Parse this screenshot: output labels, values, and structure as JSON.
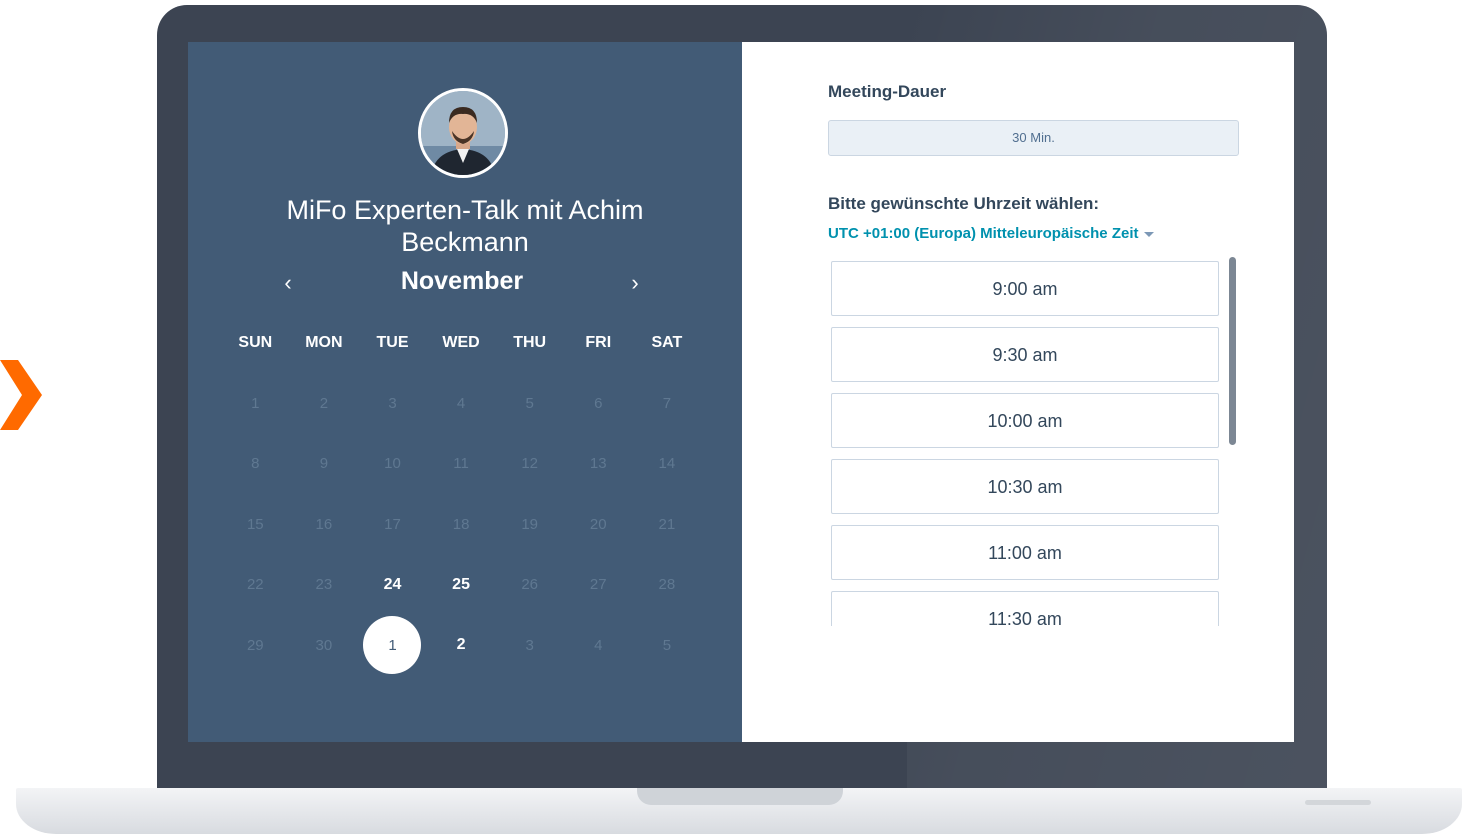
{
  "colors": {
    "left_panel_bg": "#425b76",
    "accent_link": "#0091ae",
    "brand_orange": "#ff6a00",
    "laptop_frame": "#3c4452"
  },
  "calendar": {
    "meeting_title": "MiFo Experten-Talk mit Achim Beckmann",
    "month": "November",
    "prev_icon": "chevron-left-icon",
    "next_icon": "chevron-right-icon",
    "weekdays": [
      "SUN",
      "MON",
      "TUE",
      "WED",
      "THU",
      "FRI",
      "SAT"
    ],
    "days": [
      {
        "label": "1",
        "state": "disabled"
      },
      {
        "label": "2",
        "state": "disabled"
      },
      {
        "label": "3",
        "state": "disabled"
      },
      {
        "label": "4",
        "state": "disabled"
      },
      {
        "label": "5",
        "state": "disabled"
      },
      {
        "label": "6",
        "state": "disabled"
      },
      {
        "label": "7",
        "state": "disabled"
      },
      {
        "label": "8",
        "state": "disabled"
      },
      {
        "label": "9",
        "state": "disabled"
      },
      {
        "label": "10",
        "state": "disabled"
      },
      {
        "label": "11",
        "state": "disabled"
      },
      {
        "label": "12",
        "state": "disabled"
      },
      {
        "label": "13",
        "state": "disabled"
      },
      {
        "label": "14",
        "state": "disabled"
      },
      {
        "label": "15",
        "state": "disabled"
      },
      {
        "label": "16",
        "state": "disabled"
      },
      {
        "label": "17",
        "state": "disabled"
      },
      {
        "label": "18",
        "state": "disabled"
      },
      {
        "label": "19",
        "state": "disabled"
      },
      {
        "label": "20",
        "state": "disabled"
      },
      {
        "label": "21",
        "state": "disabled"
      },
      {
        "label": "22",
        "state": "disabled"
      },
      {
        "label": "23",
        "state": "disabled"
      },
      {
        "label": "24",
        "state": "available"
      },
      {
        "label": "25",
        "state": "available"
      },
      {
        "label": "26",
        "state": "disabled"
      },
      {
        "label": "27",
        "state": "disabled"
      },
      {
        "label": "28",
        "state": "disabled"
      },
      {
        "label": "29",
        "state": "disabled"
      },
      {
        "label": "30",
        "state": "disabled"
      },
      {
        "label": "1",
        "state": "selected"
      },
      {
        "label": "2",
        "state": "available"
      },
      {
        "label": "3",
        "state": "disabled"
      },
      {
        "label": "4",
        "state": "disabled"
      },
      {
        "label": "5",
        "state": "disabled"
      }
    ]
  },
  "booking": {
    "duration_label": "Meeting-Dauer",
    "duration_value": "30 Min.",
    "time_prompt": "Bitte gewünschte Uhrzeit wählen:",
    "timezone": "UTC +01:00 (Europa) Mitteleuropäische Zeit",
    "time_slots": [
      "9:00 am",
      "9:30 am",
      "10:00 am",
      "10:30 am",
      "11:00 am",
      "11:30 am"
    ]
  }
}
